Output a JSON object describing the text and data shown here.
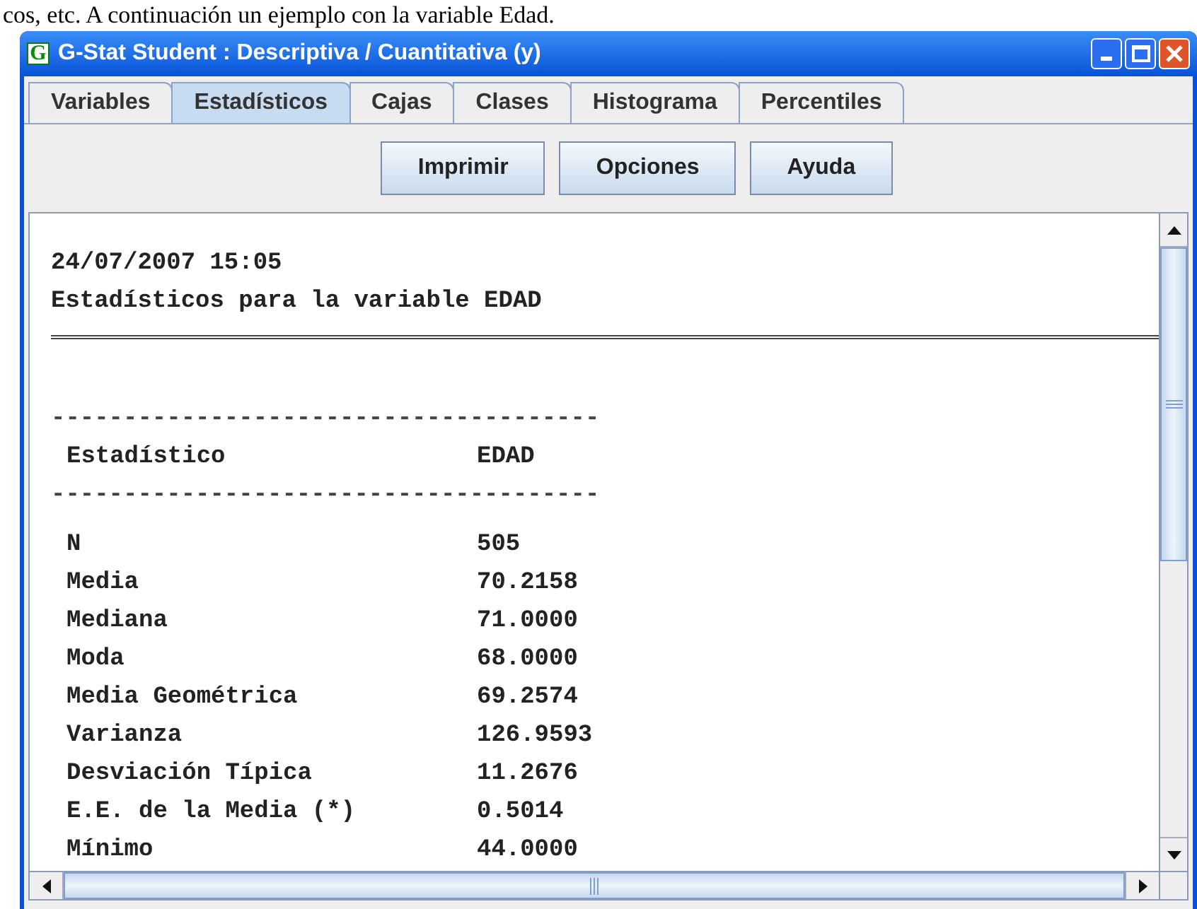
{
  "document_text": "cos, etc. A continuación un ejemplo con la variable Edad.",
  "window": {
    "title": "G-Stat Student : Descriptiva / Cuantitativa (y)",
    "app_icon": "G"
  },
  "tabs": [
    {
      "label": "Variables",
      "selected": false
    },
    {
      "label": "Estadísticos",
      "selected": true
    },
    {
      "label": "Cajas",
      "selected": false
    },
    {
      "label": "Clases",
      "selected": false
    },
    {
      "label": "Histograma",
      "selected": false
    },
    {
      "label": "Percentiles",
      "selected": false
    }
  ],
  "buttons": [
    "Imprimir",
    "Opciones",
    "Ayuda"
  ],
  "report": {
    "timestamp": "24/07/2007 15:05",
    "heading": "Estadísticos para la variable EDAD",
    "separator": "--------------------------------------",
    "columns": [
      "Estadístico",
      "EDAD"
    ],
    "rows": [
      {
        "label": "N",
        "value": "505"
      },
      {
        "label": "Media",
        "value": "70.2158"
      },
      {
        "label": "Mediana",
        "value": "71.0000"
      },
      {
        "label": "Moda",
        "value": "68.0000"
      },
      {
        "label": "Media Geométrica",
        "value": "69.2574"
      },
      {
        "label": "Varianza",
        "value": "126.9593"
      },
      {
        "label": "Desviación Típica",
        "value": "11.2676"
      },
      {
        "label": "E.E. de la Media (*)",
        "value": "0.5014"
      },
      {
        "label": "Mínimo",
        "value": "44.0000"
      }
    ]
  }
}
